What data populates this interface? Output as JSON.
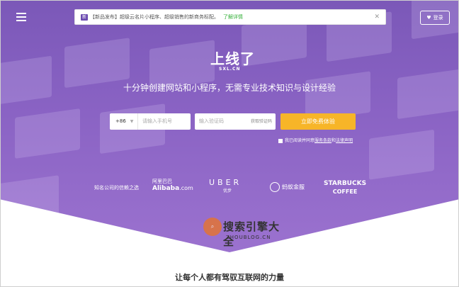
{
  "header": {
    "notice_badge": "新",
    "notice_text": "【新品发布】超级云名片小程序、超级销售的新商务标配。",
    "notice_link": "了解详情",
    "login_label": "登录"
  },
  "hero": {
    "logo": "上线了",
    "logo_sub": "SXL.CN",
    "slogan": "十分钟创建网站和小程序，无需专业技术知识与设计经验"
  },
  "form": {
    "country_code": "+86",
    "phone_placeholder": "请输入手机号",
    "code_placeholder": "输入验证码",
    "get_code_label": "获取验证码",
    "cta_label": "立即免费体验",
    "agree_text": "我已阅读并同意",
    "terms_link": "服务条款",
    "and_text": "和",
    "law_link": "法律声明"
  },
  "partners": {
    "label": "知名公司的信赖之选",
    "alibaba_cn": "阿里巴巴",
    "alibaba_en": "Alibaba",
    "alibaba_suffix": ".com",
    "uber_en": "UBER",
    "uber_cn": "优步",
    "ant": "蚂蚁金服",
    "starbucks_1": "STARBUCKS",
    "starbucks_2": "COFFEE"
  },
  "watermark": {
    "text": "搜索引擎大全",
    "url": "ZHOUBLOG.CN"
  },
  "section": {
    "title": "让每个人都有驾驭互联网的力量"
  },
  "colors": {
    "hero_purple": "#8a63c4",
    "cta_yellow": "#f7b528",
    "link_green": "#35b03a"
  }
}
